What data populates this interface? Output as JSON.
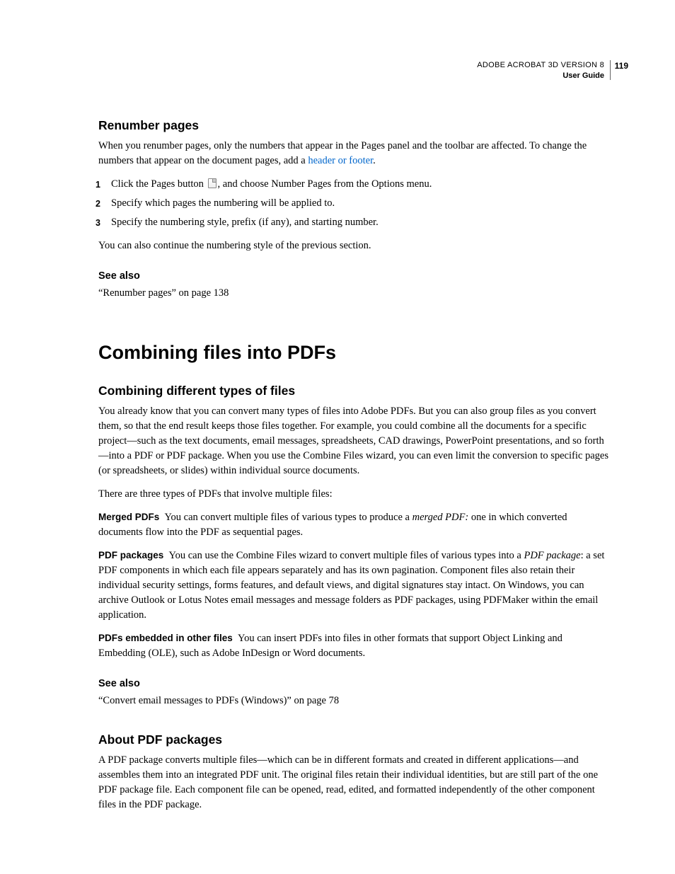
{
  "header": {
    "product": "ADOBE ACROBAT 3D VERSION 8",
    "doc": "User Guide",
    "page": "119"
  },
  "s1": {
    "title": "Renumber pages",
    "p1a": "When you renumber pages, only the numbers that appear in the Pages panel and the toolbar are affected. To change the numbers that appear on the document pages, add a ",
    "link": "header or footer",
    "p1b": ".",
    "step1a": "Click the Pages button ",
    "step1b": ", and choose Number Pages from the Options menu.",
    "step2": "Specify which pages the numbering will be applied to.",
    "step3": "Specify the numbering style, prefix (if any), and starting number.",
    "p2": "You can also continue the numbering style of the previous section.",
    "seealso_h": "See also",
    "seealso_1": "“Renumber pages” on page 138"
  },
  "s2": {
    "title": "Combining files into PDFs",
    "h_a": "Combining different types of files",
    "p_a1": "You already know that you can convert many types of files into Adobe PDFs. But you can also group files as you convert them, so that the end result keeps those files together. For example, you could combine all the documents for a specific project—such as the text documents, email messages, spreadsheets, CAD drawings, PowerPoint presentations, and so forth—into a PDF or PDF package. When you use the Combine Files wizard, you can even limit the conversion to specific pages (or spreadsheets, or slides) within individual source documents.",
    "p_a2": "There are three types of PDFs that involve multiple files:",
    "run1_label": "Merged PDFs",
    "run1_a": "You can convert multiple files of various types to produce a ",
    "run1_i": "merged PDF:",
    "run1_b": " one in which converted documents flow into the PDF as sequential pages.",
    "run2_label": "PDF packages",
    "run2_a": "You can use the Combine Files wizard to convert multiple files of various types into a ",
    "run2_i": "PDF package",
    "run2_b": ": a set PDF components in which each file appears separately and has its own pagination. Component files also retain their individual security settings, forms features, and default views, and digital signatures stay intact. On Windows, you can archive Outlook or Lotus Notes email messages and message folders as PDF packages, using PDFMaker within the email application.",
    "run3_label": "PDFs embedded in other files",
    "run3_a": "You can insert PDFs into files in other formats that support Object Linking and Embedding (OLE), such as Adobe InDesign or Word documents.",
    "seealso_h": "See also",
    "seealso_1": "“Convert email messages to PDFs (Windows)” on page 78",
    "h_b": "About PDF packages",
    "p_b1": "A PDF package converts multiple files—which can be in different formats and created in different applications—and assembles them into an integrated PDF unit. The original files retain their individual identities, but are still part of the one PDF package file. Each component file can be opened, read, edited, and formatted independently of the other component files in the PDF package."
  }
}
